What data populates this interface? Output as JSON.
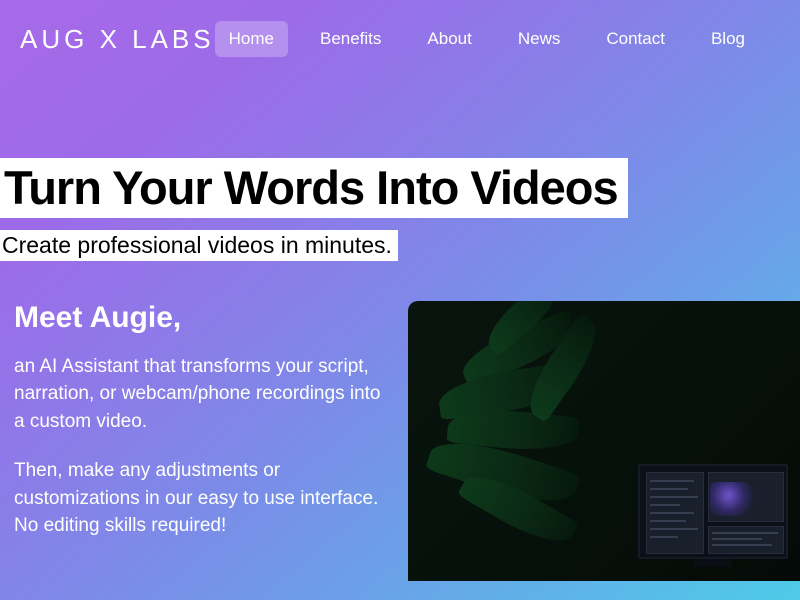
{
  "header": {
    "logo": "AUG X LABS",
    "nav": [
      {
        "label": "Home",
        "active": true
      },
      {
        "label": "Benefits",
        "active": false
      },
      {
        "label": "About",
        "active": false
      },
      {
        "label": "News",
        "active": false
      },
      {
        "label": "Contact",
        "active": false
      },
      {
        "label": "Blog",
        "active": false
      }
    ]
  },
  "hero": {
    "title": "Turn Your Words Into Videos",
    "subtitle": "Create professional videos in minutes."
  },
  "meet": {
    "title": "Meet Augie,",
    "p1": "an AI Assistant that transforms your script, narration, or webcam/phone recordings into a custom video.",
    "p2": "Then, make any adjustments or customizations in our easy to use interface. No editing skills required!"
  }
}
